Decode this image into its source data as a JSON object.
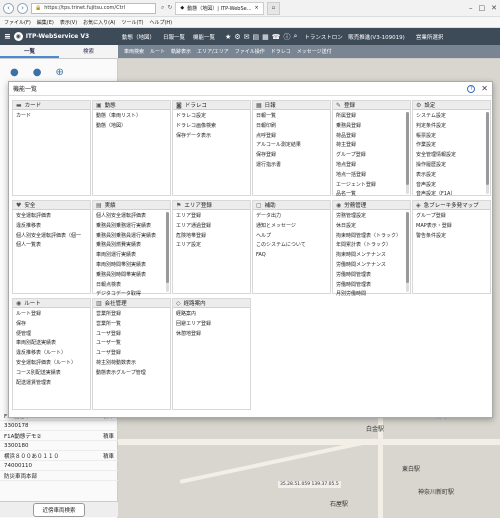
{
  "browser": {
    "url": "https://tps.trinet.fujitsu.com/Ctrl",
    "tabs": [
      {
        "label": "動態（地図）| ITP-WebSe..."
      },
      {
        "label": ""
      }
    ],
    "menu": [
      "ファイル(F)",
      "編集(E)",
      "表示(V)",
      "お気に入り(A)",
      "ツール(T)",
      "ヘルプ(H)"
    ]
  },
  "app": {
    "title": "ITP-WebService V3",
    "header_items": [
      "動態（地図）",
      "日報一覧",
      "機能一覧"
    ],
    "org_label": "トランストロン　販売推進(V3-109019)",
    "branch_label": "営業所選択",
    "tabs": [
      "一覧",
      "検索"
    ],
    "tools": [
      "車両検索",
      "ルート",
      "軌跡表示",
      "エリア/エリア",
      "ファイル操作",
      "ドラレコ",
      "メッセージ送付"
    ]
  },
  "modal": {
    "title": "機能一覧",
    "sections": [
      {
        "name": "カード",
        "icon": "card-icon",
        "items": [
          "カード"
        ]
      },
      {
        "name": "動態",
        "icon": "truck-icon",
        "items": [
          "動態（車両リスト）",
          "動態（地図）"
        ]
      },
      {
        "name": "ドラレコ",
        "icon": "camera-icon",
        "items": [
          "ドラレコ設定",
          "ドラレコ画像検索",
          "保存データ表示"
        ]
      },
      {
        "name": "日報",
        "icon": "calendar-icon",
        "items": [
          "日報一覧",
          "日報印刷",
          "点呼登録",
          "アルコール測定結果",
          "保存登録",
          "運行指示書"
        ]
      },
      {
        "name": "登録",
        "icon": "edit-icon",
        "items": [
          "所属登録",
          "乗務員登録",
          "荷品登録",
          "荷主登録",
          "グループ登録",
          "地点登録",
          "地点一括登録",
          "エージェント登録",
          "品名一覧"
        ]
      },
      {
        "name": "設定",
        "icon": "gear-icon",
        "items": [
          "システム設定",
          "判定条件設定",
          "帳票設定",
          "作業設定",
          "安全管理情報設定",
          "操作履歴設定",
          "表示設定",
          "音声設定",
          "音声設定（F1A）"
        ]
      },
      {
        "name": "安全",
        "icon": "heart-icon",
        "items": [
          "安全運転評価表",
          "違反推移表",
          "個人別安全運転評価表（個一",
          "個人一覧表"
        ]
      },
      {
        "name": "実績",
        "icon": "chart-icon",
        "items": [
          "個人別安全運転評価表",
          "乗務員別乗務運行実績表",
          "乗務員別乗務員運行実績表",
          "乗務員別燃費実績表",
          "車両別運行実績表",
          "車両別時間帯別実績表",
          "乗務員別時間帯実績表",
          "日報点検表",
          "デジタコデータ取得"
        ]
      },
      {
        "name": "エリア登録",
        "icon": "flag-icon",
        "items": [
          "エリア登録",
          "エリア通過登録",
          "危険地帯登録",
          "エリア設定"
        ]
      },
      {
        "name": "補助",
        "icon": "box-icon",
        "items": [
          "データ出力",
          "通知とメッセージ",
          "ヘルプ",
          "このシステムについて",
          "FAQ"
        ]
      },
      {
        "name": "労務管理",
        "icon": "people-icon",
        "items": [
          "労務管理設定",
          "休日設定",
          "拘束時間管理表（トラック）",
          "年間累計表（トラック）",
          "拘束時間メンテナンス",
          "労働時間メンテナンス",
          "労働時間管理表",
          "労働時間管理表",
          "月別労働時間"
        ]
      },
      {
        "name": "急ブレーキ多発マップ",
        "icon": "map-icon",
        "items": [
          "グループ登録",
          "MAP表示・登録",
          "警告条件設定"
        ]
      },
      {
        "name": "ルート",
        "icon": "pin-icon",
        "items": [
          "ルート登録",
          "保存",
          "便管理",
          "車両別配送実績表",
          "違反推移表（ルート）",
          "安全運転評価表（ルート）",
          "コース別配送実績表",
          "配送運賃管理表"
        ]
      },
      {
        "name": "会社管理",
        "icon": "building-icon",
        "items": [
          "営業所登録",
          "営業所一覧",
          "ユーザ登録",
          "ユーザ一覧",
          "ユーザ登録",
          "荷主別荷動数表示",
          "動態表示グループ管理"
        ]
      },
      {
        "name": "経路案内",
        "icon": "route-icon",
        "items": [
          "経路案内",
          "回避エリア登録",
          "休憩地登録"
        ]
      }
    ]
  },
  "left_list": [
    {
      "title": "F1A動態デモ①",
      "status": "積車"
    },
    {
      "title": "3300178",
      "status": ""
    },
    {
      "title": "F1A動態デモ②",
      "status": "積車"
    },
    {
      "title": "3300180",
      "status": ""
    },
    {
      "title": "横浜８００あ０１１０",
      "status": "積車"
    },
    {
      "title": "74000110",
      "status": ""
    },
    {
      "title": "防災車両本部",
      "status": ""
    }
  ],
  "left_bottom_button": "近傍車両検索",
  "map_labels": [
    "白金駅",
    "東白駅",
    "麻布",
    "神奈川新町駅",
    "石屋駅"
  ],
  "map_coord": "35.28.51.059 139.37.05.5"
}
